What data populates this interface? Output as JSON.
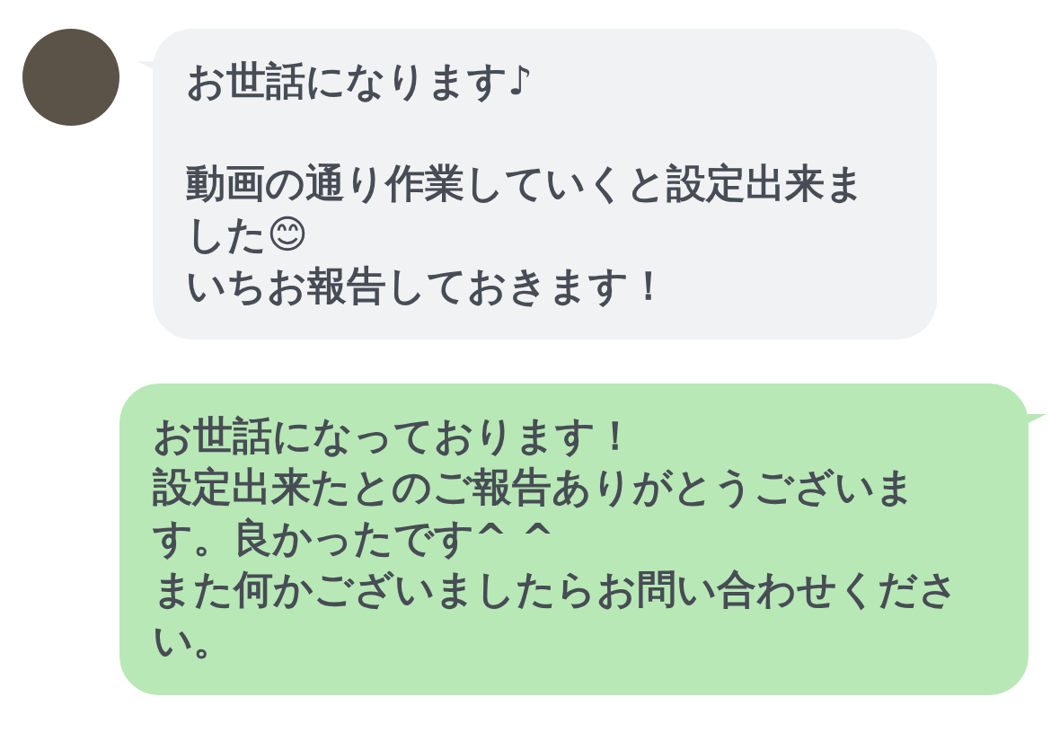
{
  "messages": [
    {
      "kind": "incoming",
      "paragraphs": [
        [
          "お世話になります♪"
        ],
        [
          "動画の通り作業していくと設定出来ました😊",
          "いちお報告しておきます！"
        ]
      ]
    },
    {
      "kind": "outgoing",
      "paragraphs": [
        [
          "お世話になっております！",
          "設定出来たとのご報告ありがとうございます。良かったです^ ^",
          "また何かございましたらお問い合わせください。"
        ]
      ]
    }
  ]
}
